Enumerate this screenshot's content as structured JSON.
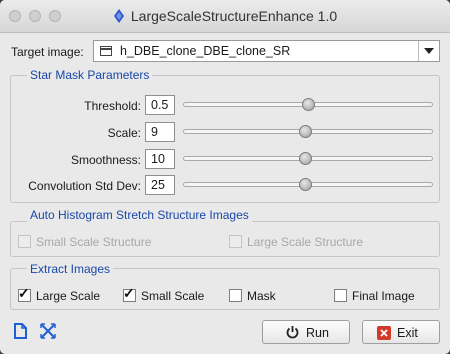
{
  "window": {
    "title": "LargeScaleStructureEnhance 1.0"
  },
  "target": {
    "label": "Target image:",
    "value": "h_DBE_clone_DBE_clone_SR"
  },
  "star_mask": {
    "title": "Star Mask Parameters",
    "params": [
      {
        "label": "Threshold:",
        "value": "0.5",
        "slider": 0.5
      },
      {
        "label": "Scale:",
        "value": "9",
        "slider": 0.49
      },
      {
        "label": "Smoothness:",
        "value": "10",
        "slider": 0.49
      },
      {
        "label": "Convolution Std Dev:",
        "value": "25",
        "slider": 0.49
      }
    ]
  },
  "auto_histogram": {
    "title": "Auto Histogram Stretch Structure Images",
    "small_label": "Small Scale Structure",
    "small_checked": false,
    "large_label": "Large Scale Structure",
    "large_checked": false
  },
  "extract": {
    "title": "Extract Images",
    "items": [
      {
        "label": "Large Scale",
        "checked": true
      },
      {
        "label": "Small Scale",
        "checked": true
      },
      {
        "label": "Mask",
        "checked": false
      },
      {
        "label": "Final Image",
        "checked": false
      }
    ]
  },
  "buttons": {
    "run": "Run",
    "exit": "Exit"
  },
  "icons": {
    "new_instance": "new-instance-icon",
    "reset": "reset-icon",
    "run": "power-icon",
    "exit": "close-icon"
  },
  "colors": {
    "group_title": "#1a47a8",
    "exit_icon": "#d23a2a",
    "toolbar_icon": "#1f5fd4"
  }
}
